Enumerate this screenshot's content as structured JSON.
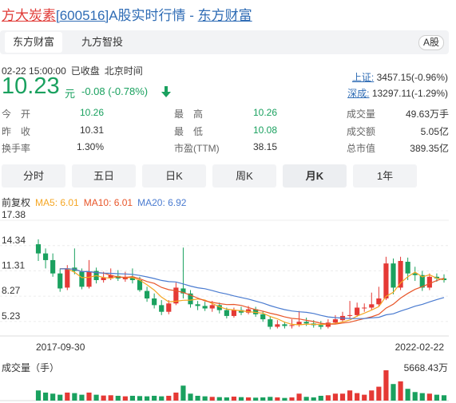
{
  "header": {
    "name": "方大炭素",
    "code": "[600516]",
    "suffix": "A股实时行情",
    "separator": " - ",
    "site": "东方财富"
  },
  "tabs": [
    {
      "label": "东方财富",
      "active": true
    },
    {
      "label": "九方智投",
      "active": false
    }
  ],
  "badge": "A股",
  "quote": {
    "time": "02-22 15:00:00",
    "status": "已收盘",
    "tz": "北京时间",
    "price": "10.23",
    "unit": "元",
    "change": "-0.08 (-0.78%)",
    "direction": "down"
  },
  "indices": [
    {
      "name": "上证:",
      "value": "3457.15(-0.96%)"
    },
    {
      "name": "深成:",
      "value": "13297.11(-1.29%)"
    }
  ],
  "stats": {
    "col1": [
      {
        "label": "今　开",
        "value": "10.26",
        "tone": "green"
      },
      {
        "label": "昨　收",
        "value": "10.31",
        "tone": "dark"
      },
      {
        "label": "换手率",
        "value": "1.30%",
        "tone": "dark"
      }
    ],
    "col2": [
      {
        "label": "最　高",
        "value": "10.26",
        "tone": "green"
      },
      {
        "label": "最　低",
        "value": "10.08",
        "tone": "green"
      },
      {
        "label": "市盈(TTM)",
        "value": "38.15",
        "tone": "dark"
      }
    ],
    "col3": [
      {
        "label": "成交量",
        "value": "49.63万手",
        "tone": "dark"
      },
      {
        "label": "成交额",
        "value": "5.05亿",
        "tone": "dark"
      },
      {
        "label": "总市值",
        "value": "389.35亿",
        "tone": "dark"
      }
    ]
  },
  "periods": [
    {
      "label": "分时",
      "active": false
    },
    {
      "label": "五日",
      "active": false
    },
    {
      "label": "日K",
      "active": false
    },
    {
      "label": "周K",
      "active": false
    },
    {
      "label": "月K",
      "active": true
    },
    {
      "label": "1年",
      "active": false
    }
  ],
  "ma_legend": {
    "adjust": "前复权",
    "items": [
      {
        "label": "MA5: 6.01",
        "color": "#f5a623"
      },
      {
        "label": "MA10: 6.01",
        "color": "#e8562a"
      },
      {
        "label": "MA20: 6.92",
        "color": "#4a7bd0"
      }
    ]
  },
  "volume": {
    "label": "成交量（手）",
    "max_label": "5668.43万"
  },
  "colors": {
    "up": "#e53935",
    "down": "#1aa15f",
    "link": "#2f6cb5"
  },
  "chart_data": {
    "type": "candlestick",
    "period": "monthly",
    "x_start": "2017-09-30",
    "x_end": "2022-02-22",
    "ylim": [
      3.5,
      17.38
    ],
    "y_ticks": [
      17.38,
      14.34,
      11.31,
      8.27,
      5.23
    ],
    "volume_max": 5668.43,
    "candles": [
      [
        14.5,
        13.4,
        15.1,
        12.5,
        1900
      ],
      [
        13.4,
        12.6,
        14.0,
        11.6,
        1500
      ],
      [
        12.6,
        11.0,
        13.4,
        10.6,
        1300
      ],
      [
        11.0,
        9.2,
        11.6,
        8.8,
        1100
      ],
      [
        9.3,
        11.6,
        12.0,
        9.0,
        1500
      ],
      [
        11.7,
        11.3,
        14.0,
        10.9,
        1400
      ],
      [
        11.2,
        9.4,
        11.6,
        9.1,
        1100
      ],
      [
        9.4,
        11.2,
        12.6,
        9.2,
        1500
      ],
      [
        11.3,
        10.2,
        11.7,
        9.8,
        1100
      ],
      [
        10.2,
        10.5,
        11.2,
        9.9,
        950
      ],
      [
        10.4,
        10.8,
        11.6,
        10.2,
        1000
      ],
      [
        10.7,
        10.4,
        11.4,
        10.1,
        900
      ],
      [
        10.3,
        10.6,
        11.2,
        10.0,
        800
      ],
      [
        10.6,
        10.2,
        11.6,
        9.8,
        900
      ],
      [
        10.2,
        9.0,
        10.6,
        8.8,
        850
      ],
      [
        8.9,
        8.0,
        9.4,
        7.6,
        800
      ],
      [
        8.0,
        7.2,
        8.6,
        6.8,
        900
      ],
      [
        7.2,
        6.4,
        7.8,
        6.0,
        800
      ],
      [
        6.4,
        7.4,
        7.8,
        6.1,
        900
      ],
      [
        7.4,
        9.3,
        9.9,
        7.2,
        1500
      ],
      [
        9.2,
        8.6,
        14.1,
        8.0,
        2800
      ],
      [
        8.6,
        7.3,
        9.0,
        6.9,
        1300
      ],
      [
        7.3,
        7.1,
        7.7,
        6.6,
        900
      ],
      [
        7.1,
        6.8,
        7.6,
        6.5,
        800
      ],
      [
        6.8,
        7.2,
        7.7,
        6.4,
        700
      ],
      [
        7.2,
        6.6,
        7.5,
        6.2,
        650
      ],
      [
        6.6,
        5.9,
        6.9,
        5.6,
        600
      ],
      [
        5.9,
        6.6,
        6.9,
        5.7,
        750
      ],
      [
        6.6,
        6.3,
        7.0,
        6.0,
        650
      ],
      [
        6.3,
        6.7,
        7.1,
        6.1,
        600
      ],
      [
        6.7,
        6.1,
        7.0,
        5.8,
        550
      ],
      [
        6.1,
        5.5,
        6.5,
        5.2,
        600
      ],
      [
        5.5,
        4.6,
        5.9,
        4.3,
        700
      ],
      [
        4.6,
        4.9,
        5.4,
        4.4,
        600
      ],
      [
        4.9,
        4.7,
        5.2,
        4.4,
        500
      ],
      [
        4.7,
        4.8,
        5.5,
        4.4,
        600
      ],
      [
        4.8,
        5.2,
        6.5,
        4.6,
        1300
      ],
      [
        5.2,
        5.0,
        5.7,
        4.7,
        700
      ],
      [
        5.0,
        4.8,
        5.4,
        4.5,
        600
      ],
      [
        4.8,
        4.6,
        5.3,
        4.3,
        900
      ],
      [
        4.6,
        5.1,
        5.5,
        4.4,
        1000
      ],
      [
        5.1,
        5.5,
        6.0,
        4.9,
        1300
      ],
      [
        5.4,
        5.9,
        6.4,
        5.2,
        1300
      ],
      [
        5.9,
        6.0,
        7.7,
        5.6,
        1900
      ],
      [
        6.0,
        6.9,
        7.5,
        5.8,
        1400
      ],
      [
        6.9,
        6.9,
        7.4,
        6.4,
        1100
      ],
      [
        6.9,
        7.3,
        8.7,
        6.6,
        1900
      ],
      [
        7.3,
        8.0,
        9.4,
        7.0,
        2600
      ],
      [
        8.0,
        12.2,
        13.0,
        7.8,
        5668
      ],
      [
        12.2,
        9.3,
        12.8,
        8.5,
        3100
      ],
      [
        9.3,
        12.5,
        13.0,
        9.0,
        3600
      ],
      [
        12.4,
        11.0,
        12.9,
        10.2,
        2200
      ],
      [
        11.0,
        10.8,
        11.8,
        10.1,
        1600
      ],
      [
        10.8,
        9.3,
        11.3,
        8.9,
        1400
      ],
      [
        9.3,
        10.6,
        11.0,
        9.0,
        1300
      ],
      [
        10.6,
        10.4,
        11.0,
        10.0,
        1100
      ],
      [
        10.4,
        10.2,
        10.9,
        9.9,
        1000
      ]
    ]
  }
}
